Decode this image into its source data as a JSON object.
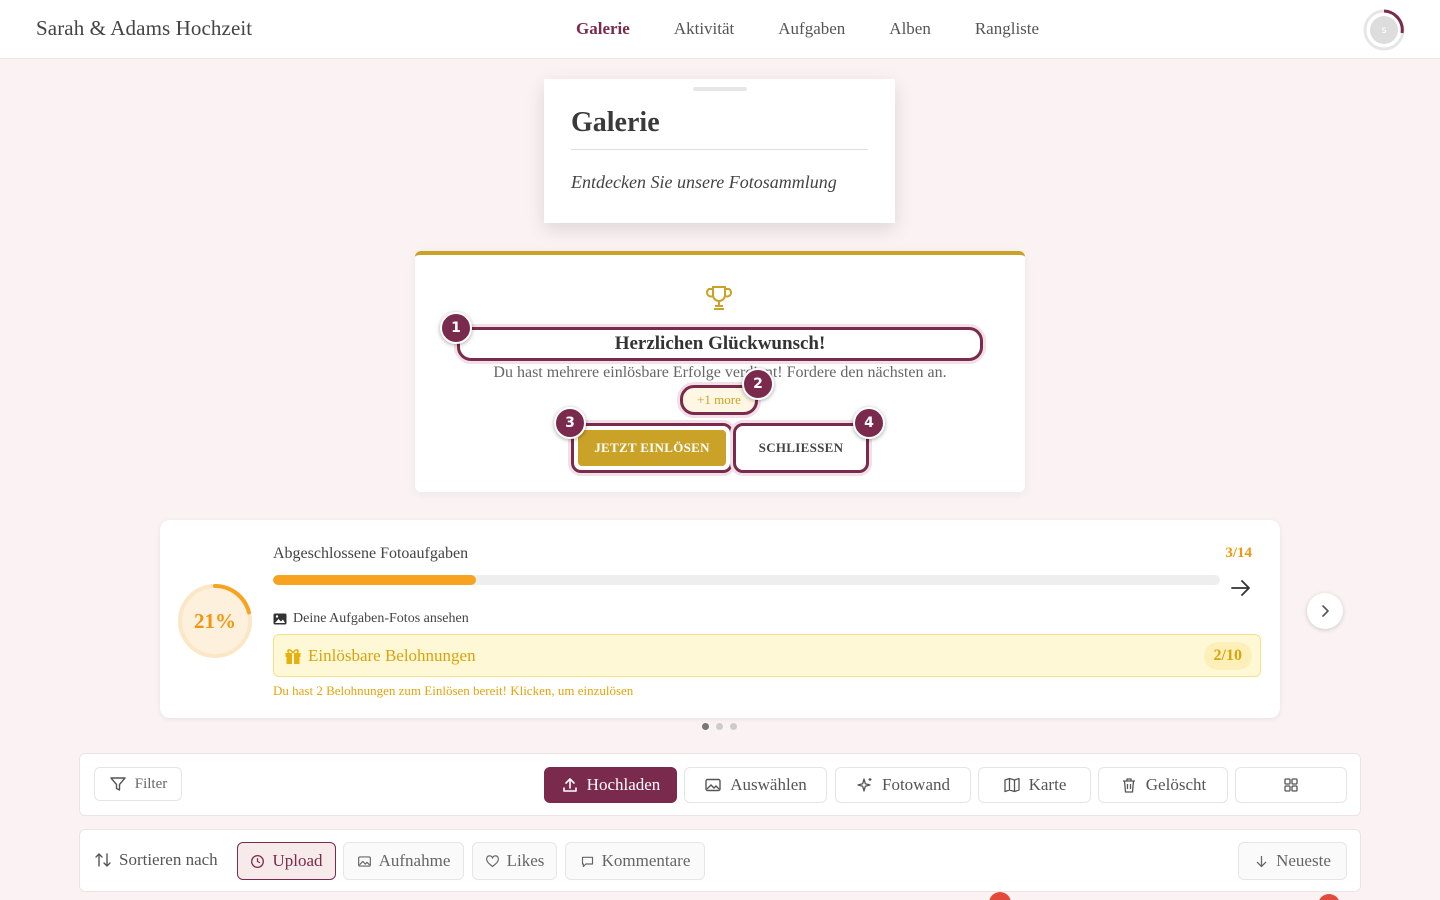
{
  "brand": "Sarah & Adams Hochzeit",
  "nav": {
    "items": [
      {
        "label": "Galerie",
        "active": true
      },
      {
        "label": "Aktivität",
        "active": false
      },
      {
        "label": "Aufgaben",
        "active": false
      },
      {
        "label": "Alben",
        "active": false
      },
      {
        "label": "Rangliste",
        "active": false
      }
    ]
  },
  "avatar": {
    "initial": "s",
    "ring_color": "#7a2a4c"
  },
  "gallery": {
    "title": "Galerie",
    "subtitle": "Entdecken Sie unsere Fotosammlung"
  },
  "congrats": {
    "icon": "trophy-icon",
    "title": "Herzlichen Glückwunsch!",
    "text": "Du hast mehrere einlösbare Erfolge verdient! Fordere den nächsten an.",
    "more": "+1 more",
    "redeem_label": "JETZT EINLÖSEN",
    "close_label": "SCHLIESSEN",
    "markers": [
      "1",
      "2",
      "3",
      "4"
    ]
  },
  "progress": {
    "percent_label": "21%",
    "percent_value": 0.21,
    "label": "Abgeschlossene Fotoaufgaben",
    "count": "3/14",
    "fill_fraction": 0.2143,
    "photos_link": "Deine Aufgaben-Fotos ansehen",
    "rewards_label": "Einlösbare Belohnungen",
    "rewards_count": "2/10",
    "rewards_note": "Du hast 2 Belohnungen zum Einlösen bereit! Klicken, um einzulösen"
  },
  "carousel": {
    "dots": 3,
    "active": 0
  },
  "toolbar": {
    "filter": "Filter",
    "upload": "Hochladen",
    "select": "Auswählen",
    "photowall": "Fotowand",
    "map": "Karte",
    "deleted": "Gelöscht"
  },
  "sort": {
    "label": "Sortieren nach",
    "upload": "Upload",
    "capture": "Aufnahme",
    "likes": "Likes",
    "comments": "Kommentare",
    "order": "Neueste"
  },
  "colors": {
    "accent": "#7a2a4c",
    "gold": "#c9a227",
    "orange": "#f0960f",
    "background": "#fbf3f3"
  }
}
